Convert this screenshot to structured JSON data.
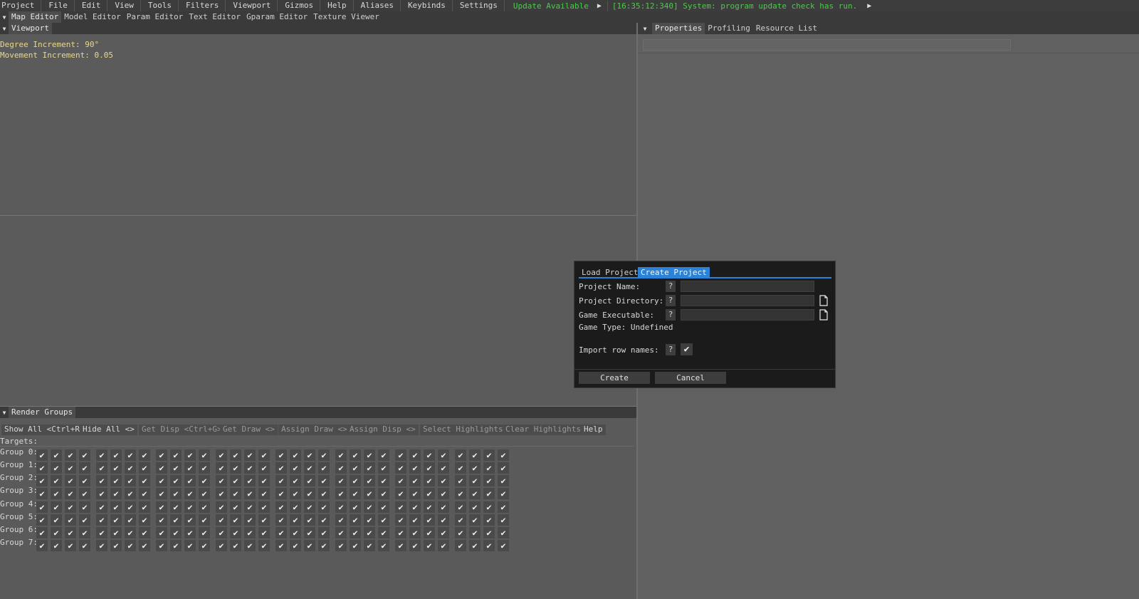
{
  "menu": {
    "items": [
      "Project",
      "File",
      "Edit",
      "View",
      "Tools",
      "Filters",
      "Viewport",
      "Gizmos",
      "Help",
      "Aliases",
      "Keybinds",
      "Settings"
    ],
    "update_label": "Update Available",
    "log_message": "[16:35:12:340] System: program update check has run."
  },
  "editor_tabs": [
    "Map Editor",
    "Model Editor",
    "Param Editor",
    "Text Editor",
    "Gparam Editor",
    "Texture Viewer"
  ],
  "viewport": {
    "tab": "Viewport",
    "degree_increment": "Degree Increment: 90°",
    "movement_increment": "Movement Increment: 0.05"
  },
  "right_panel": {
    "tabs": [
      "Properties",
      "Profiling",
      "Resource List"
    ]
  },
  "render_groups": {
    "tab": "Render Groups",
    "buttons": [
      "Show All <Ctrl+R>",
      "Hide All <>",
      "Get Disp <Ctrl+G>",
      "Get Draw <>",
      "Assign Draw <>",
      "Assign Disp <>",
      "Select Highlights",
      "Clear Highlights",
      "Help"
    ],
    "targets_label": "Targets:",
    "groups": [
      "Group 0:",
      "Group 1:",
      "Group 2:",
      "Group 3:",
      "Group 4:",
      "Group 5:",
      "Group 6:",
      "Group 7:"
    ],
    "checkbox_count_per_group": 32,
    "checked": true
  },
  "dialog": {
    "tabs": [
      "Load Project",
      "Create Project"
    ],
    "active_tab": "Create Project",
    "fields": {
      "project_name": "Project Name:",
      "project_directory": "Project Directory:",
      "game_executable": "Game Executable:",
      "game_type": "Game Type: Undefined",
      "import_row_names": "Import row names:"
    },
    "help_glyph": "?",
    "import_row_names_checked": true,
    "create_label": "Create",
    "cancel_label": "Cancel"
  },
  "colors": {
    "accent": "#2a83d8",
    "status_green": "#4ec94e",
    "viewport_text": "#e8d98a"
  }
}
